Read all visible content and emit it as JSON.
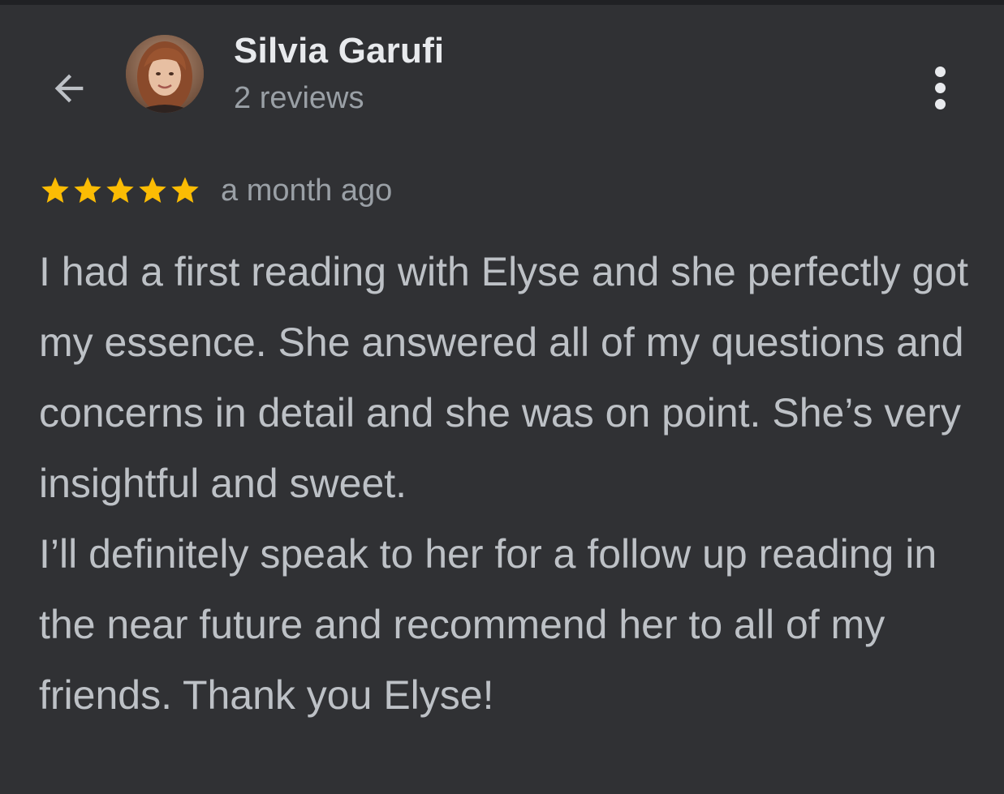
{
  "reviewer": {
    "name": "Silvia Garufi",
    "review_count": "2 reviews"
  },
  "review": {
    "rating": 5,
    "max_rating": 5,
    "time_ago": "a month ago",
    "paragraphs": [
      "I had a first reading with Elyse and she perfectly got my essence. She answered all of my questions and concerns in detail and she was on point. She’s very insightful and sweet.",
      "I’ll definitely speak to her for a follow up reading in the near future and recommend her to all of my friends. Thank you Elyse!"
    ]
  },
  "icons": {
    "back": "arrow-back-icon",
    "more": "more-vert-icon",
    "star": "star-icon"
  },
  "colors": {
    "background": "#303134",
    "star": "#fbbc04",
    "name_text": "#e8eaed",
    "secondary_text": "#9aa0a6",
    "body_text": "#bdc1c6"
  }
}
